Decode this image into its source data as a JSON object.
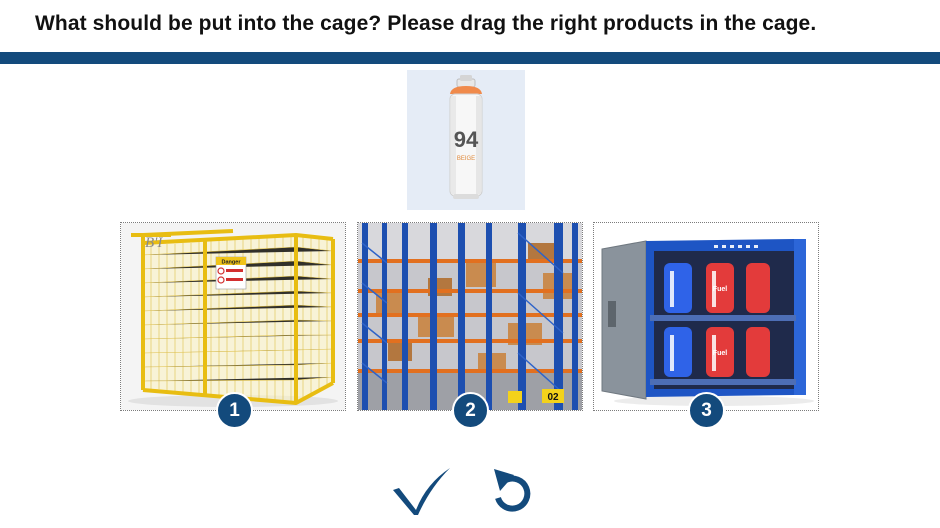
{
  "question": "What should be put into the cage? Please drag the right products in the cage.",
  "product": {
    "name": "spray-can",
    "label_number": "94",
    "label_text": "BEIGE"
  },
  "options": [
    {
      "number": "1",
      "image": "yellow-wire-mesh-gas-cylinder-cage",
      "sign_text": "Danger"
    },
    {
      "number": "2",
      "image": "warehouse-pallet-racking",
      "sign_text": "02"
    },
    {
      "number": "3",
      "image": "blue-gas-cylinder-storage-cabinet",
      "sign_text": "Fuel"
    }
  ],
  "actions": {
    "submit_icon": "checkmark-icon",
    "reset_icon": "undo-icon"
  },
  "colors": {
    "accent": "#134a7c",
    "question_text": "#111111",
    "product_bg": "#e5ecf6"
  }
}
